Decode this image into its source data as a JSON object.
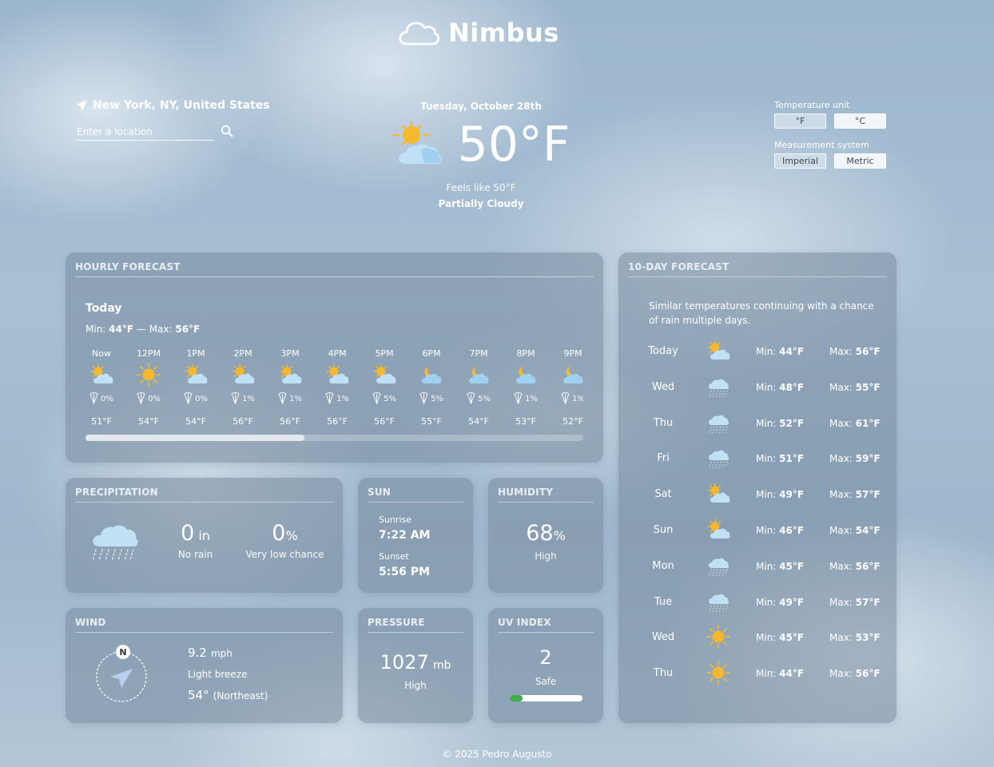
{
  "app": {
    "name": "Nimbus"
  },
  "location": {
    "label": "New York, NY, United States"
  },
  "search": {
    "placeholder": "Enter a location",
    "value": ""
  },
  "current": {
    "date": "Tuesday, October 28th",
    "temperature": "50°F",
    "feels_like": "Feels like 50°F",
    "condition": "Partially Cloudy",
    "icon": "partly-cloudy-icon"
  },
  "settings": {
    "temp_unit_label": "Temperature unit",
    "temp_units": [
      "°F",
      "°C"
    ],
    "temp_selected": "°F",
    "system_label": "Measurement system",
    "systems": [
      "Imperial",
      "Metric"
    ],
    "system_selected": "Imperial"
  },
  "hourly": {
    "title": "HOURLY FORECAST",
    "day_label": "Today",
    "min_prefix": "Min: ",
    "min": "44°F",
    "sep": " — Max: ",
    "max": "56°F",
    "scroll_fraction": 0.44,
    "hours": [
      {
        "time": "Now",
        "icon": "partly-cloudy-icon",
        "rain": "0%",
        "temp": "51°F"
      },
      {
        "time": "12PM",
        "icon": "sun-icon",
        "rain": "0%",
        "temp": "54°F"
      },
      {
        "time": "1PM",
        "icon": "partly-cloudy-icon",
        "rain": "0%",
        "temp": "54°F"
      },
      {
        "time": "2PM",
        "icon": "partly-cloudy-icon",
        "rain": "1%",
        "temp": "56°F"
      },
      {
        "time": "3PM",
        "icon": "partly-cloudy-icon",
        "rain": "1%",
        "temp": "56°F"
      },
      {
        "time": "4PM",
        "icon": "partly-cloudy-icon",
        "rain": "1%",
        "temp": "56°F"
      },
      {
        "time": "5PM",
        "icon": "partly-cloudy-icon",
        "rain": "5%",
        "temp": "56°F"
      },
      {
        "time": "6PM",
        "icon": "cloudy-night-icon",
        "rain": "5%",
        "temp": "55°F"
      },
      {
        "time": "7PM",
        "icon": "cloudy-night-icon",
        "rain": "5%",
        "temp": "54°F"
      },
      {
        "time": "8PM",
        "icon": "cloudy-night-icon",
        "rain": "1%",
        "temp": "53°F"
      },
      {
        "time": "9PM",
        "icon": "cloudy-night-icon",
        "rain": "1%",
        "temp": "52°F"
      }
    ]
  },
  "ten_day": {
    "title": "10-DAY FORECAST",
    "summary": "Similar temperatures continuing with a chance of rain multiple days.",
    "min_prefix": "Min: ",
    "max_prefix": "Max: ",
    "days": [
      {
        "day": "Today",
        "icon": "partly-cloudy-icon",
        "min": "44°F",
        "max": "56°F"
      },
      {
        "day": "Wed",
        "icon": "rain-icon",
        "min": "48°F",
        "max": "55°F"
      },
      {
        "day": "Thu",
        "icon": "rain-icon",
        "min": "52°F",
        "max": "61°F"
      },
      {
        "day": "Fri",
        "icon": "rain-icon",
        "min": "51°F",
        "max": "59°F"
      },
      {
        "day": "Sat",
        "icon": "partly-cloudy-icon",
        "min": "49°F",
        "max": "57°F"
      },
      {
        "day": "Sun",
        "icon": "partly-cloudy-icon",
        "min": "46°F",
        "max": "54°F"
      },
      {
        "day": "Mon",
        "icon": "rain-icon",
        "min": "45°F",
        "max": "56°F"
      },
      {
        "day": "Tue",
        "icon": "rain-icon",
        "min": "49°F",
        "max": "57°F"
      },
      {
        "day": "Wed",
        "icon": "sun-icon",
        "min": "45°F",
        "max": "53°F"
      },
      {
        "day": "Thu",
        "icon": "sun-icon",
        "min": "44°F",
        "max": "56°F"
      }
    ]
  },
  "precipitation": {
    "title": "PRECIPITATION",
    "amount": "0",
    "amount_unit": "in",
    "amount_label": "No rain",
    "chance": "0",
    "chance_unit": "%",
    "chance_label": "Very low chance"
  },
  "sun": {
    "title": "SUN",
    "sunrise_label": "Sunrise",
    "sunrise": "7:22 AM",
    "sunset_label": "Sunset",
    "sunset": "5:56 PM"
  },
  "humidity": {
    "title": "HUMIDITY",
    "value": "68",
    "unit": "%",
    "label": "High"
  },
  "wind": {
    "title": "WIND",
    "speed": "9.2",
    "speed_unit": "mph",
    "description": "Light breeze",
    "direction_deg": "54°",
    "direction_label": "(Northeast)",
    "compass_label": "N"
  },
  "pressure": {
    "title": "PRESSURE",
    "value": "1027",
    "unit": "mb",
    "label": "High"
  },
  "uv": {
    "title": "UV INDEX",
    "value": "2",
    "label": "Safe",
    "fraction": 0.18
  },
  "footer": {
    "text": "© 2025 Pedro Augusto"
  },
  "colors": {
    "sun": "#f5b82e",
    "cloud": "#bfe0f5",
    "rain": "#dfe9f2",
    "uv_low": "#3fae4a"
  }
}
